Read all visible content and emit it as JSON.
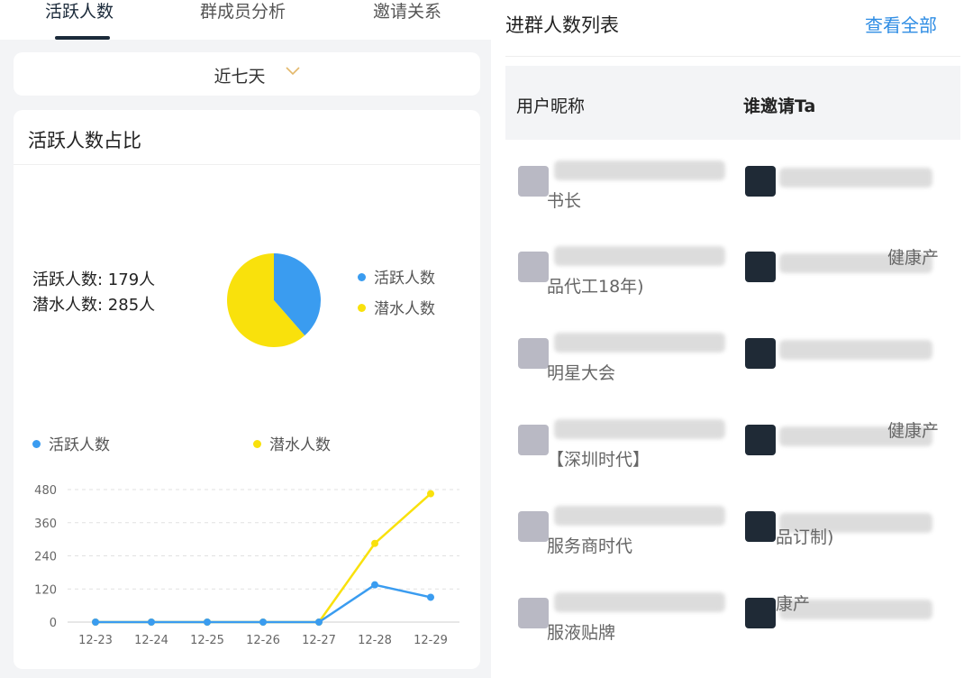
{
  "tabs": [
    {
      "label": "活跃人数",
      "active": true
    },
    {
      "label": "群成员分析",
      "active": false
    },
    {
      "label": "邀请关系",
      "active": false
    }
  ],
  "date_filter": {
    "label": "近七天"
  },
  "active_ratio_card": {
    "title": "活跃人数占比",
    "active_stat": "活跃人数: 179人",
    "lurker_stat": "潜水人数: 285人",
    "legend": [
      {
        "label": "活跃人数",
        "color": "#3a9cf0"
      },
      {
        "label": "潜水人数",
        "color": "#f9e10c"
      }
    ]
  },
  "trend_legend": [
    {
      "label": "活跃人数",
      "color": "#3a9cf0"
    },
    {
      "label": "潜水人数",
      "color": "#f9e10c"
    }
  ],
  "chart_data": [
    {
      "type": "pie",
      "labels": [
        "活跃人数",
        "潜水人数"
      ],
      "values": [
        179,
        285
      ],
      "colors": [
        "#3a9cf0",
        "#f9e10c"
      ]
    },
    {
      "type": "line",
      "categories": [
        "12-23",
        "12-24",
        "12-25",
        "12-26",
        "12-27",
        "12-28",
        "12-29"
      ],
      "yticks": [
        0,
        120,
        240,
        360,
        480
      ],
      "ylim": [
        0,
        480
      ],
      "grid": true,
      "series": [
        {
          "name": "活跃人数",
          "color": "#3a9cf0",
          "values": [
            0,
            0,
            0,
            0,
            0,
            135,
            90
          ]
        },
        {
          "name": "潜水人数",
          "color": "#f9e10c",
          "values": [
            0,
            0,
            0,
            0,
            0,
            285,
            465
          ]
        }
      ]
    }
  ],
  "member_list": {
    "title": "进群人数列表",
    "view_all": "查看全部",
    "columns": [
      "用户昵称",
      "谁邀请Ta"
    ],
    "rows": [
      {
        "user_text": "书长",
        "inviter_text": ""
      },
      {
        "user_text": "品代工18年)",
        "inviter_text": "健康产"
      },
      {
        "user_text": "明星大会",
        "inviter_text": ""
      },
      {
        "user_text": "【深圳时代】",
        "inviter_text": "健康产"
      },
      {
        "user_text": "服务商时代",
        "inviter_text": "品订制)"
      },
      {
        "user_text": "服液贴牌",
        "inviter_text": "康产"
      }
    ]
  }
}
